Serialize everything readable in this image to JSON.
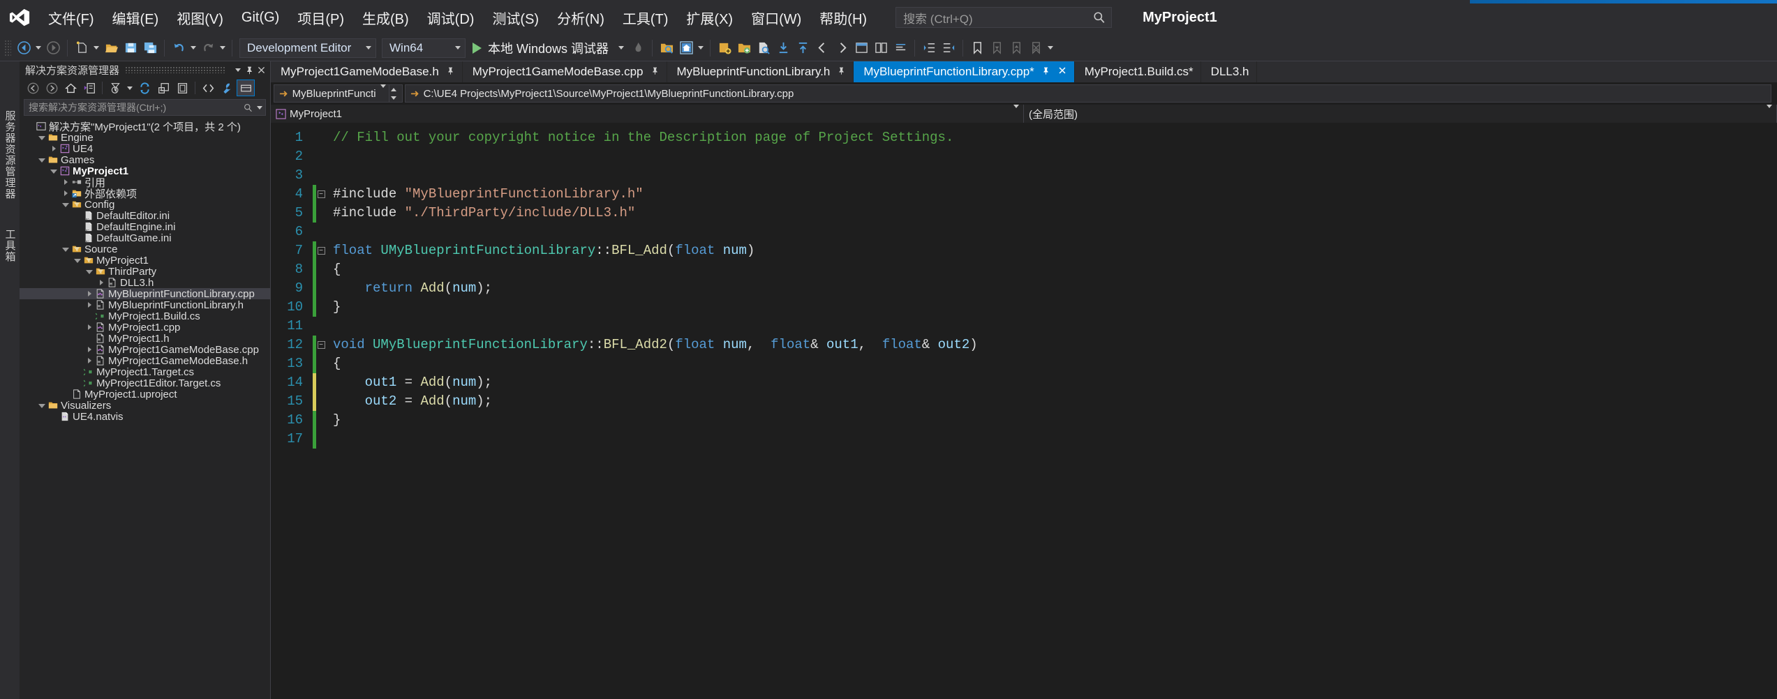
{
  "window": {
    "title_project": "MyProject1",
    "accent_color": "#007acc"
  },
  "menu": {
    "items": [
      {
        "label": "文件(F)",
        "name": "menu-file"
      },
      {
        "label": "编辑(E)",
        "name": "menu-edit"
      },
      {
        "label": "视图(V)",
        "name": "menu-view"
      },
      {
        "label": "Git(G)",
        "name": "menu-git"
      },
      {
        "label": "项目(P)",
        "name": "menu-project"
      },
      {
        "label": "生成(B)",
        "name": "menu-build"
      },
      {
        "label": "调试(D)",
        "name": "menu-debug"
      },
      {
        "label": "测试(S)",
        "name": "menu-test"
      },
      {
        "label": "分析(N)",
        "name": "menu-analyze"
      },
      {
        "label": "工具(T)",
        "name": "menu-tools"
      },
      {
        "label": "扩展(X)",
        "name": "menu-extensions"
      },
      {
        "label": "窗口(W)",
        "name": "menu-window"
      },
      {
        "label": "帮助(H)",
        "name": "menu-help"
      }
    ],
    "search_placeholder": "搜索 (Ctrl+Q)"
  },
  "toolbar": {
    "configuration": "Development Editor",
    "platform": "Win64",
    "run_target": "本地 Windows 调试器"
  },
  "solution_explorer": {
    "title": "解决方案资源管理器",
    "search_placeholder": "搜索解决方案资源管理器(Ctrl+;)",
    "tree": [
      {
        "label": "解决方案\"MyProject1\"(2 个项目，共 2 个)",
        "depth": 0,
        "icon": "solution-icon",
        "twisty": "none",
        "bold": false,
        "selected": false
      },
      {
        "label": "Engine",
        "depth": 1,
        "icon": "folder-icon",
        "twisty": "open",
        "bold": false,
        "selected": false
      },
      {
        "label": "UE4",
        "depth": 2,
        "icon": "project-icon",
        "twisty": "closed",
        "bold": false,
        "selected": false
      },
      {
        "label": "Games",
        "depth": 1,
        "icon": "folder-icon",
        "twisty": "open",
        "bold": false,
        "selected": false
      },
      {
        "label": "MyProject1",
        "depth": 2,
        "icon": "project-icon",
        "twisty": "open",
        "bold": true,
        "selected": false
      },
      {
        "label": "引用",
        "depth": 3,
        "icon": "references-icon",
        "twisty": "closed",
        "bold": false,
        "selected": false
      },
      {
        "label": "外部依赖项",
        "depth": 3,
        "icon": "external-deps-icon",
        "twisty": "closed",
        "bold": false,
        "selected": false
      },
      {
        "label": "Config",
        "depth": 3,
        "icon": "filter-folder-icon",
        "twisty": "open",
        "bold": false,
        "selected": false
      },
      {
        "label": "DefaultEditor.ini",
        "depth": 4,
        "icon": "ini-file-icon",
        "twisty": "none",
        "bold": false,
        "selected": false
      },
      {
        "label": "DefaultEngine.ini",
        "depth": 4,
        "icon": "ini-file-icon",
        "twisty": "none",
        "bold": false,
        "selected": false
      },
      {
        "label": "DefaultGame.ini",
        "depth": 4,
        "icon": "ini-file-icon",
        "twisty": "none",
        "bold": false,
        "selected": false
      },
      {
        "label": "Source",
        "depth": 3,
        "icon": "filter-folder-icon",
        "twisty": "open",
        "bold": false,
        "selected": false
      },
      {
        "label": "MyProject1",
        "depth": 4,
        "icon": "filter-folder-icon",
        "twisty": "open",
        "bold": false,
        "selected": false
      },
      {
        "label": "ThirdParty",
        "depth": 5,
        "icon": "filter-folder-icon",
        "twisty": "open",
        "bold": false,
        "selected": false
      },
      {
        "label": "DLL3.h",
        "depth": 6,
        "icon": "h-file-icon",
        "twisty": "closed",
        "bold": false,
        "selected": false
      },
      {
        "label": "MyBlueprintFunctionLibrary.cpp",
        "depth": 5,
        "icon": "cpp-file-icon",
        "twisty": "closed",
        "bold": false,
        "selected": true
      },
      {
        "label": "MyBlueprintFunctionLibrary.h",
        "depth": 5,
        "icon": "h-file-icon",
        "twisty": "closed",
        "bold": false,
        "selected": false
      },
      {
        "label": "MyProject1.Build.cs",
        "depth": 5,
        "icon": "cs-file-icon",
        "twisty": "none",
        "bold": false,
        "selected": false
      },
      {
        "label": "MyProject1.cpp",
        "depth": 5,
        "icon": "cpp-file-icon",
        "twisty": "closed",
        "bold": false,
        "selected": false
      },
      {
        "label": "MyProject1.h",
        "depth": 5,
        "icon": "h-file-icon",
        "twisty": "none",
        "bold": false,
        "selected": false
      },
      {
        "label": "MyProject1GameModeBase.cpp",
        "depth": 5,
        "icon": "cpp-file-icon",
        "twisty": "closed",
        "bold": false,
        "selected": false
      },
      {
        "label": "MyProject1GameModeBase.h",
        "depth": 5,
        "icon": "h-file-icon",
        "twisty": "closed",
        "bold": false,
        "selected": false
      },
      {
        "label": "MyProject1.Target.cs",
        "depth": 4,
        "icon": "cs-file-icon",
        "twisty": "none",
        "bold": false,
        "selected": false
      },
      {
        "label": "MyProject1Editor.Target.cs",
        "depth": 4,
        "icon": "cs-file-icon",
        "twisty": "none",
        "bold": false,
        "selected": false
      },
      {
        "label": "MyProject1.uproject",
        "depth": 3,
        "icon": "generic-file-icon",
        "twisty": "none",
        "bold": false,
        "selected": false
      },
      {
        "label": "Visualizers",
        "depth": 1,
        "icon": "folder-icon",
        "twisty": "open",
        "bold": false,
        "selected": false
      },
      {
        "label": "UE4.natvis",
        "depth": 2,
        "icon": "natvis-file-icon",
        "twisty": "none",
        "bold": false,
        "selected": false
      }
    ]
  },
  "vertical_tabs": [
    {
      "label": "服务器资源管理器",
      "name": "vtab-server-explorer"
    },
    {
      "label": "工具箱",
      "name": "vtab-toolbox"
    }
  ],
  "editor_tabs": [
    {
      "label": "MyProject1GameModeBase.h",
      "active": false,
      "pinned": true,
      "modified": false
    },
    {
      "label": "MyProject1GameModeBase.cpp",
      "active": false,
      "pinned": true,
      "modified": false
    },
    {
      "label": "MyBlueprintFunctionLibrary.h",
      "active": false,
      "pinned": true,
      "modified": false
    },
    {
      "label": "MyBlueprintFunctionLibrary.cpp*",
      "active": true,
      "pinned": true,
      "modified": true
    },
    {
      "label": "MyProject1.Build.cs*",
      "active": false,
      "pinned": false,
      "modified": true
    },
    {
      "label": "DLL3.h",
      "active": false,
      "pinned": false,
      "modified": false
    }
  ],
  "navbar": {
    "project_label": "MyBlueprintFunctionLibr",
    "file_path": "C:\\UE4 Projects\\MyProject1\\Source\\MyProject1\\MyBlueprintFunctionLibrary.cpp"
  },
  "context_bar": {
    "scope_left": "MyProject1",
    "scope_right": "(全局范围)"
  },
  "code": {
    "lines": [
      {
        "n": "1",
        "fold": "none",
        "change": "none",
        "tokens": [
          {
            "t": "// Fill out your copyright notice in the Description page of Project Settings.",
            "c": "cmt"
          }
        ]
      },
      {
        "n": "2",
        "fold": "none",
        "change": "none",
        "tokens": []
      },
      {
        "n": "3",
        "fold": "none",
        "change": "none",
        "tokens": []
      },
      {
        "n": "4",
        "fold": "minus",
        "change": "green",
        "tokens": [
          {
            "t": "#include ",
            "c": "op"
          },
          {
            "t": "\"MyBlueprintFunctionLibrary.h\"",
            "c": "str"
          }
        ]
      },
      {
        "n": "5",
        "fold": "none",
        "change": "green",
        "tokens": [
          {
            "t": "#include ",
            "c": "op"
          },
          {
            "t": "\"./ThirdParty/include/DLL3.h\"",
            "c": "str"
          }
        ]
      },
      {
        "n": "6",
        "fold": "none",
        "change": "none",
        "tokens": []
      },
      {
        "n": "7",
        "fold": "minus",
        "change": "green",
        "tokens": [
          {
            "t": "float ",
            "c": "kw"
          },
          {
            "t": "UMyBlueprintFunctionLibrary",
            "c": "typ"
          },
          {
            "t": "::",
            "c": "op"
          },
          {
            "t": "BFL_Add",
            "c": "fn"
          },
          {
            "t": "(",
            "c": "op"
          },
          {
            "t": "float ",
            "c": "kw"
          },
          {
            "t": "num",
            "c": "var"
          },
          {
            "t": ")",
            "c": "op"
          }
        ]
      },
      {
        "n": "8",
        "fold": "none",
        "change": "green",
        "tokens": [
          {
            "t": "{",
            "c": "op"
          }
        ]
      },
      {
        "n": "9",
        "fold": "none",
        "change": "green",
        "tokens": [
          {
            "t": "    ",
            "c": "ind"
          },
          {
            "t": "return ",
            "c": "kw"
          },
          {
            "t": "Add",
            "c": "fn"
          },
          {
            "t": "(",
            "c": "op"
          },
          {
            "t": "num",
            "c": "var"
          },
          {
            "t": ");",
            "c": "op"
          }
        ]
      },
      {
        "n": "10",
        "fold": "none",
        "change": "green",
        "tokens": [
          {
            "t": "}",
            "c": "op"
          }
        ]
      },
      {
        "n": "11",
        "fold": "none",
        "change": "none",
        "tokens": []
      },
      {
        "n": "12",
        "fold": "minus",
        "change": "green",
        "tokens": [
          {
            "t": "void ",
            "c": "kw"
          },
          {
            "t": "UMyBlueprintFunctionLibrary",
            "c": "typ"
          },
          {
            "t": "::",
            "c": "op"
          },
          {
            "t": "BFL_Add2",
            "c": "fn"
          },
          {
            "t": "(",
            "c": "op"
          },
          {
            "t": "float ",
            "c": "kw"
          },
          {
            "t": "num",
            "c": "var"
          },
          {
            "t": ",  ",
            "c": "op"
          },
          {
            "t": "float",
            "c": "kw"
          },
          {
            "t": "& ",
            "c": "op"
          },
          {
            "t": "out1",
            "c": "var"
          },
          {
            "t": ",  ",
            "c": "op"
          },
          {
            "t": "float",
            "c": "kw"
          },
          {
            "t": "& ",
            "c": "op"
          },
          {
            "t": "out2",
            "c": "var"
          },
          {
            "t": ")",
            "c": "op"
          }
        ]
      },
      {
        "n": "13",
        "fold": "none",
        "change": "green",
        "tokens": [
          {
            "t": "{",
            "c": "op"
          }
        ]
      },
      {
        "n": "14",
        "fold": "none",
        "change": "yellow",
        "tokens": [
          {
            "t": "    ",
            "c": "ind"
          },
          {
            "t": "out1",
            "c": "var"
          },
          {
            "t": " = ",
            "c": "op"
          },
          {
            "t": "Add",
            "c": "fn"
          },
          {
            "t": "(",
            "c": "op"
          },
          {
            "t": "num",
            "c": "var"
          },
          {
            "t": ");",
            "c": "op"
          }
        ]
      },
      {
        "n": "15",
        "fold": "none",
        "change": "yellow",
        "tokens": [
          {
            "t": "    ",
            "c": "ind"
          },
          {
            "t": "out2",
            "c": "var"
          },
          {
            "t": " = ",
            "c": "op"
          },
          {
            "t": "Add",
            "c": "fn"
          },
          {
            "t": "(",
            "c": "op"
          },
          {
            "t": "num",
            "c": "var"
          },
          {
            "t": ");",
            "c": "op"
          }
        ]
      },
      {
        "n": "16",
        "fold": "none",
        "change": "green",
        "tokens": [
          {
            "t": "}",
            "c": "op"
          }
        ]
      },
      {
        "n": "17",
        "fold": "none",
        "change": "green",
        "tokens": []
      }
    ]
  }
}
